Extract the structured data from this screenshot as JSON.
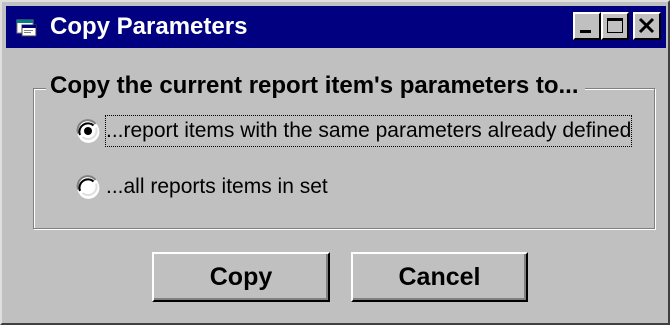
{
  "window": {
    "title": "Copy Parameters",
    "title_icon": "app-window-icon",
    "controls": {
      "minimize_icon": "minimize-icon",
      "maximize_icon": "maximize-icon",
      "close_icon": "close-icon"
    }
  },
  "group": {
    "label": "Copy the current report item's parameters to..."
  },
  "options": [
    {
      "label": "...report items with the same parameters already defined",
      "selected": true
    },
    {
      "label": "...all reports items in set",
      "selected": false
    }
  ],
  "buttons": {
    "copy_label": "Copy",
    "cancel_label": "Cancel"
  },
  "colors": {
    "titlebar": "#000080",
    "face": "#c0c0c0"
  }
}
